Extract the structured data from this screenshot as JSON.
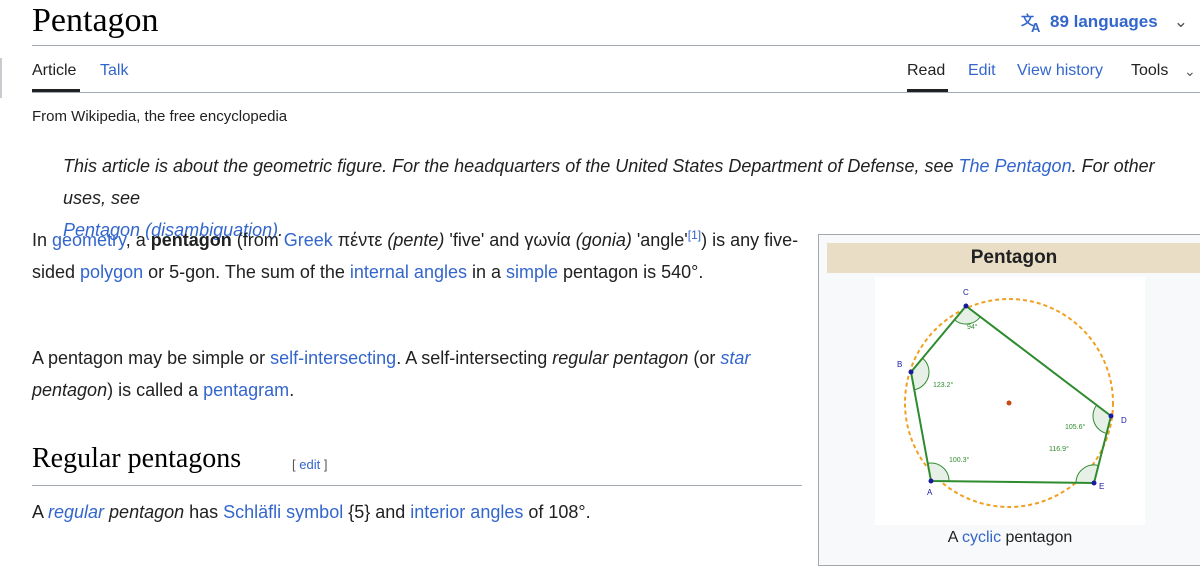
{
  "header": {
    "title": "Pentagon",
    "languages": "89 languages",
    "languages_icon": "translate-icon"
  },
  "tabs": {
    "article": "Article",
    "talk": "Talk",
    "read": "Read",
    "edit": "Edit",
    "view_history": "View history",
    "tools": "Tools"
  },
  "tagline": "From Wikipedia, the free encyclopedia",
  "hatnote": {
    "prefix": "This article is about the geometric figure. For the headquarters of the United States Department of Defense, see ",
    "link1": "The Pentagon",
    "mid": ". For other uses, see ",
    "link2": "Pentagon (disambiguation)",
    "suffix": "."
  },
  "paragraph1": {
    "t1": "In ",
    "l_geometry": "geometry",
    "t2": ", a ",
    "b_pentagon": "pentagon",
    "t3": " (from ",
    "l_greek": "Greek",
    "t4": " πέντε ",
    "i_pente": "(pente)",
    "t5": " 'five' and γωνία ",
    "i_gonia": "(gonia)",
    "t6": " 'angle'",
    "ref": "[1]",
    "t7": ") is any five-sided ",
    "l_polygon": "polygon",
    "t8": " or 5-gon. The sum of the ",
    "l_internal": "internal angles",
    "t9": " in a ",
    "l_simple": "simple",
    "t10": " pentagon is 540°."
  },
  "paragraph2": {
    "t1": "A pentagon may be simple or ",
    "l_self": "self-intersecting",
    "t2": ". A self-intersecting ",
    "i_regular": "regular pentagon",
    "t3": " (or ",
    "l_star": "star",
    "i_pentagon": " pentagon",
    "t4": ") is called a ",
    "l_pentagram": "pentagram",
    "t5": "."
  },
  "section": {
    "heading": "Regular pentagons",
    "edit_open": "[ ",
    "edit": "edit",
    "edit_close": " ]"
  },
  "paragraph3": {
    "t1": "A ",
    "l_regular": "regular",
    "i_pentagon": " pentagon",
    "t2": " has ",
    "l_schlafli": "Schläfli symbol",
    "t3": " {5} and ",
    "l_interior": "interior angles",
    "t4": " of 108°."
  },
  "infobox": {
    "title": "Pentagon",
    "caption_prefix": "A ",
    "caption_link": "cyclic",
    "caption_suffix": " pentagon",
    "diagram": {
      "vertex_labels": [
        "A",
        "B",
        "C",
        "D",
        "E"
      ],
      "angle_labels": [
        "94°",
        "123.2°",
        "105.6°",
        "116.9°",
        "100.3°"
      ],
      "colors": {
        "edges": "#2e8b2e",
        "circle": "#f0a020",
        "vertices": "#1a1aa0",
        "center": "#c84a10",
        "arcs": "#2e8b2e"
      }
    }
  },
  "colors": {
    "link": "#3366cc",
    "infobox_title_bg": "#eaddc5"
  }
}
